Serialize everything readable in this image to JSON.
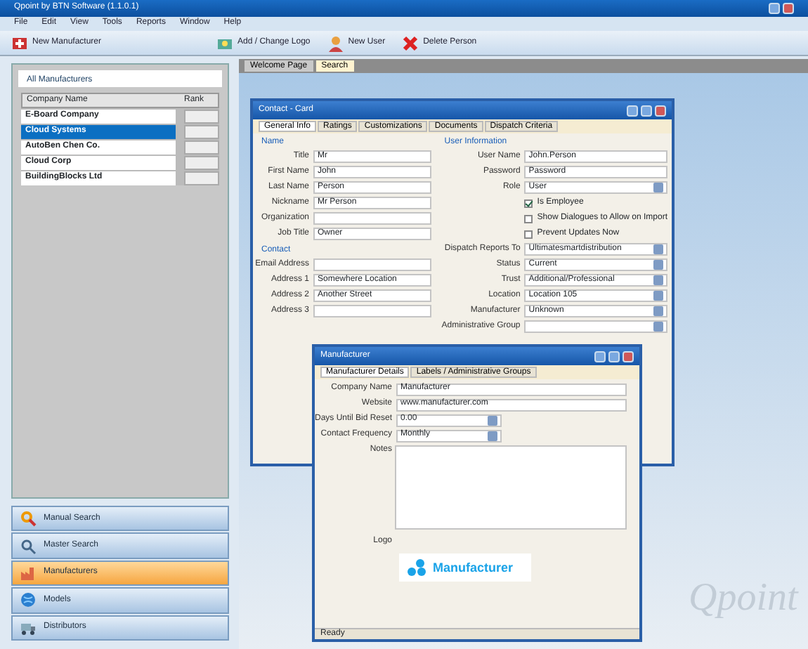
{
  "window": {
    "title": "Qpoint by BTN Software (1.1.0.1)"
  },
  "menu": [
    "File",
    "Edit",
    "View",
    "Tools",
    "Reports",
    "Window",
    "Help"
  ],
  "toolbar": [
    {
      "label": "New Manufacturer",
      "kind": "add"
    },
    {
      "label": "Add / Change Logo",
      "kind": "logo"
    },
    {
      "label": "New User",
      "kind": "user"
    },
    {
      "label": "Delete Person",
      "kind": "delete"
    }
  ],
  "left_panel": {
    "title": "All Manufacturers",
    "columns": [
      "Company Name",
      "Rank"
    ],
    "rows": [
      {
        "name": "E-Board Company",
        "selected": false
      },
      {
        "name": "Cloud Systems",
        "selected": true
      },
      {
        "name": "AutoBen Chen Co.",
        "selected": false
      },
      {
        "name": "Cloud Corp",
        "selected": false
      },
      {
        "name": "BuildingBlocks Ltd",
        "selected": false
      }
    ]
  },
  "nav": [
    {
      "label": "Manual Search",
      "selected": false,
      "kind": "search"
    },
    {
      "label": "Master Search",
      "selected": false,
      "kind": "master"
    },
    {
      "label": "Manufacturers",
      "selected": true,
      "kind": "factory"
    },
    {
      "label": "Models",
      "selected": false,
      "kind": "globe"
    },
    {
      "label": "Distributors",
      "selected": false,
      "kind": "truck"
    }
  ],
  "doc_tabs": [
    {
      "label": "Welcome Page",
      "selected": false
    },
    {
      "label": "Search",
      "selected": true
    }
  ],
  "contact_window": {
    "title": "Contact - Card",
    "tabs": [
      {
        "label": "General Info",
        "selected": true
      },
      {
        "label": "Ratings",
        "selected": false
      },
      {
        "label": "Customizations",
        "selected": false
      },
      {
        "label": "Documents",
        "selected": false
      },
      {
        "label": "Dispatch Criteria",
        "selected": false
      }
    ],
    "name_section": {
      "heading": "Name",
      "fields": [
        {
          "label": "Title",
          "value": "Mr"
        },
        {
          "label": "First Name",
          "value": "John"
        },
        {
          "label": "Last Name",
          "value": "Person"
        },
        {
          "label": "Nickname",
          "value": "Mr Person"
        },
        {
          "label": "Organization"
        },
        {
          "label": "Job Title",
          "value": "Owner"
        }
      ]
    },
    "contact_section": {
      "heading": "Contact",
      "fields": [
        {
          "label": "Email Address"
        },
        {
          "label": "Address 1",
          "value": "Somewhere Location"
        },
        {
          "label": "Address 2",
          "value": "Another Street"
        },
        {
          "label": "Address 3"
        }
      ]
    },
    "user_section": {
      "heading": "User Information",
      "fields": [
        {
          "kind": "text",
          "label": "User Name",
          "value": "John.Person"
        },
        {
          "kind": "text",
          "label": "Password",
          "value": "Password"
        },
        {
          "kind": "select",
          "label": "Role",
          "value": "User"
        },
        {
          "kind": "check",
          "label": "Is Employee",
          "checked": true
        },
        {
          "kind": "check",
          "label": "Show Dialogues to Allow on Import",
          "checked": false
        },
        {
          "kind": "check",
          "label": "Prevent Updates Now",
          "checked": false
        },
        {
          "kind": "select",
          "label": "Dispatch Reports To",
          "value": "Ultimatesmartdistribution"
        },
        {
          "kind": "select",
          "label": "Status",
          "value": "Current"
        },
        {
          "kind": "select",
          "label": "Trust",
          "value": "Additional/Professional"
        },
        {
          "kind": "select",
          "label": "Location",
          "value": "Location 105"
        },
        {
          "kind": "select",
          "label": "Manufacturer",
          "value": "Unknown"
        },
        {
          "kind": "select",
          "label": "Administrative Group"
        }
      ]
    }
  },
  "manufacturer_dialog": {
    "title": "Manufacturer",
    "tabs": [
      {
        "label": "Manufacturer Details",
        "selected": true
      },
      {
        "label": "Labels / Administrative Groups",
        "selected": false
      }
    ],
    "fields": [
      {
        "kind": "text",
        "label": "Company Name",
        "value": "Manufacturer"
      },
      {
        "kind": "text",
        "label": "Website",
        "value": "www.manufacturer.com"
      },
      {
        "kind": "select",
        "label": "Days Until Bid Reset",
        "value": "0.00"
      },
      {
        "kind": "select",
        "label": "Contact Frequency",
        "value": "Monthly"
      }
    ],
    "notes_label": "Notes",
    "logo_label": "Logo",
    "logo_text": "Manufacturer",
    "status": "Ready"
  },
  "background_logo": "Qpoint"
}
